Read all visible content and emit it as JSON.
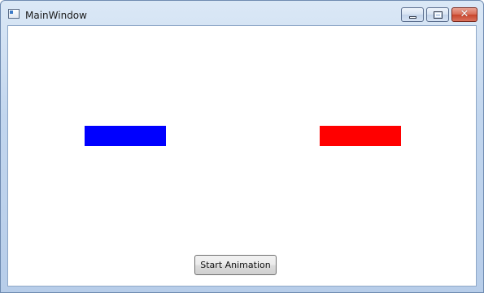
{
  "window": {
    "title": "MainWindow",
    "caption_buttons": [
      {
        "name": "minimize",
        "icon": "minimize-icon"
      },
      {
        "name": "maximize",
        "icon": "maximize-icon"
      },
      {
        "name": "close",
        "icon": "close-icon",
        "glyph": "✕"
      }
    ]
  },
  "content": {
    "shapes": [
      {
        "name": "blue-rectangle",
        "color": "#0000ff"
      },
      {
        "name": "red-rectangle",
        "color": "#ff0000"
      }
    ],
    "start_button_label": "Start Animation"
  }
}
